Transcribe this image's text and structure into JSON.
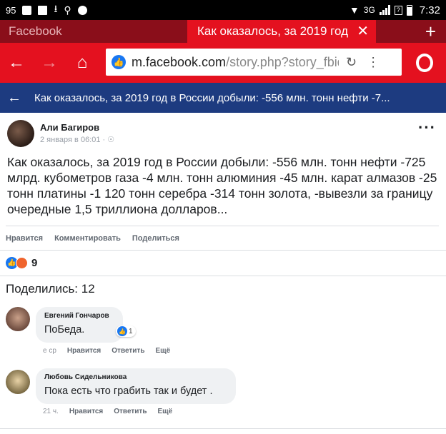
{
  "status_bar": {
    "notification_count": "95",
    "network": "3G",
    "time": "7:32"
  },
  "tabs": [
    {
      "label": "Facebook",
      "active": false
    },
    {
      "label": "Как оказалось, за 2019 год",
      "active": true
    }
  ],
  "url_bar": {
    "domain": "m.facebook.com",
    "path": "/story.php?story_fbid"
  },
  "page_header": {
    "title": "Как оказалось, за 2019 год в России добыли: -556 млн. тонн нефти -7..."
  },
  "post": {
    "author": "Али Багиров",
    "meta": "2 января в 06:01 · ☉",
    "text": "Как оказалось, за 2019 год в России добыли: -556 млн. тонн нефти -725 млрд. кубометров газа -4 млн. тонн алюминия -45 млн. карат алмазов -25 тонн платины -1 120 тонн серебра -314 тонн золота, -вывезли за границу очередные 1,5 триллиона долларов...",
    "actions": {
      "like": "Нравится",
      "comment": "Комментировать",
      "share": "Поделиться"
    },
    "reaction_count": "9",
    "shares": "Поделились: 12"
  },
  "comments": [
    {
      "author": "Евгений Гончаров",
      "text": "ПоБеда.",
      "likes": "1",
      "time": "е ср",
      "like": "Нравится",
      "reply": "Ответить",
      "more": "Ещё"
    },
    {
      "author": "Любовь Сидельникова",
      "text": "Пока есть что грабить так и будет .",
      "time": "21 ч.",
      "like": "Нравится",
      "reply": "Ответить",
      "more": "Ещё"
    }
  ],
  "colors": {
    "opera_red": "#e4111f",
    "tab_bar": "#8a0e1a",
    "fb_header": "#1d3b80",
    "fb_blue": "#1877f2"
  }
}
